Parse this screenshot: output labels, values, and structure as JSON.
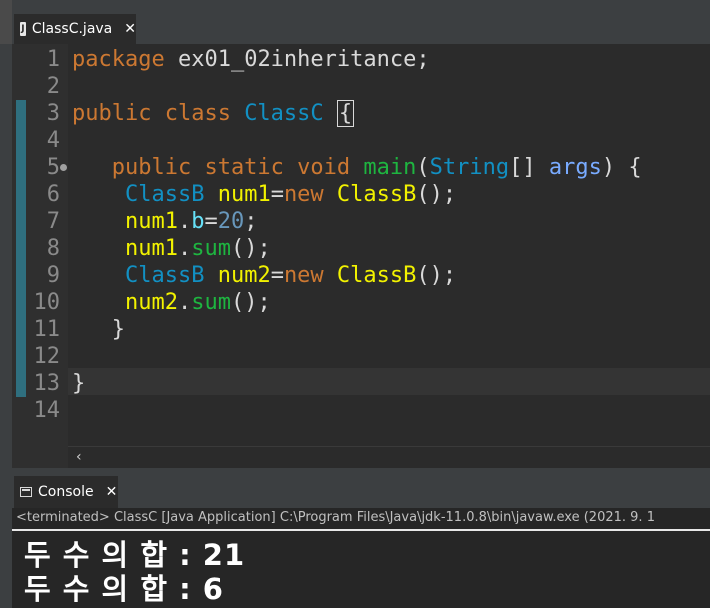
{
  "editor": {
    "tab": {
      "label": "ClassC.java",
      "icon": "java-file-icon",
      "close": "✕"
    },
    "scroll_left": "‹",
    "lines": [
      {
        "n": "1",
        "tokens": [
          {
            "t": "package ",
            "c": "kw"
          },
          {
            "t": "ex01_02inheritance;",
            "c": "pl"
          }
        ]
      },
      {
        "n": "2",
        "tokens": []
      },
      {
        "n": "3",
        "tokens": [
          {
            "t": "public class ",
            "c": "kw"
          },
          {
            "t": "ClassC ",
            "c": "cls"
          },
          {
            "t": "{",
            "c": "cursor"
          }
        ]
      },
      {
        "n": "4",
        "tokens": []
      },
      {
        "n": "5",
        "tokens": [
          {
            "t": "   public static void ",
            "c": "kw"
          },
          {
            "t": "main",
            "c": "fn"
          },
          {
            "t": "(",
            "c": "pl"
          },
          {
            "t": "String",
            "c": "cls"
          },
          {
            "t": "[] ",
            "c": "pl"
          },
          {
            "t": "args",
            "c": "prm"
          },
          {
            "t": ") {",
            "c": "pl"
          }
        ]
      },
      {
        "n": "6",
        "tokens": [
          {
            "t": "    ClassB ",
            "c": "cls"
          },
          {
            "t": "num1",
            "c": "var"
          },
          {
            "t": "=",
            "c": "pl"
          },
          {
            "t": "new ",
            "c": "kw"
          },
          {
            "t": "ClassB",
            "c": "var"
          },
          {
            "t": "();",
            "c": "pl"
          }
        ]
      },
      {
        "n": "7",
        "tokens": [
          {
            "t": "    num1",
            "c": "var"
          },
          {
            "t": ".",
            "c": "pl"
          },
          {
            "t": "b",
            "c": "fld"
          },
          {
            "t": "=",
            "c": "pl"
          },
          {
            "t": "20",
            "c": "num"
          },
          {
            "t": ";",
            "c": "pl"
          }
        ]
      },
      {
        "n": "8",
        "tokens": [
          {
            "t": "    num1",
            "c": "var"
          },
          {
            "t": ".",
            "c": "pl"
          },
          {
            "t": "sum",
            "c": "fn"
          },
          {
            "t": "();",
            "c": "pl"
          }
        ]
      },
      {
        "n": "9",
        "tokens": [
          {
            "t": "    ClassB ",
            "c": "cls"
          },
          {
            "t": "num2",
            "c": "var"
          },
          {
            "t": "=",
            "c": "pl"
          },
          {
            "t": "new ",
            "c": "kw"
          },
          {
            "t": "ClassB",
            "c": "var"
          },
          {
            "t": "();",
            "c": "pl"
          }
        ]
      },
      {
        "n": "10",
        "tokens": [
          {
            "t": "    num2",
            "c": "var"
          },
          {
            "t": ".",
            "c": "pl"
          },
          {
            "t": "sum",
            "c": "fn"
          },
          {
            "t": "();",
            "c": "pl"
          }
        ]
      },
      {
        "n": "11",
        "tokens": [
          {
            "t": "   }",
            "c": "pl"
          }
        ]
      },
      {
        "n": "12",
        "tokens": []
      },
      {
        "n": "13",
        "tokens": [
          {
            "t": "}",
            "c": "pl"
          }
        ]
      },
      {
        "n": "14",
        "tokens": []
      }
    ]
  },
  "console": {
    "tab": {
      "label": "Console",
      "icon": "console-icon",
      "close": "✕"
    },
    "status": "<terminated> ClassC [Java Application] C:\\Program Files\\Java\\jdk-11.0.8\\bin\\javaw.exe  (2021. 9. 1",
    "output": [
      "두 수 의 합 : 21",
      "두 수 의 합 : 6"
    ]
  },
  "colors": {
    "keyword": "#cc7832",
    "class": "#1290c3",
    "method": "#1eb540",
    "variable": "#f2f200",
    "number": "#6897bb",
    "background": "#2b2b2b"
  }
}
